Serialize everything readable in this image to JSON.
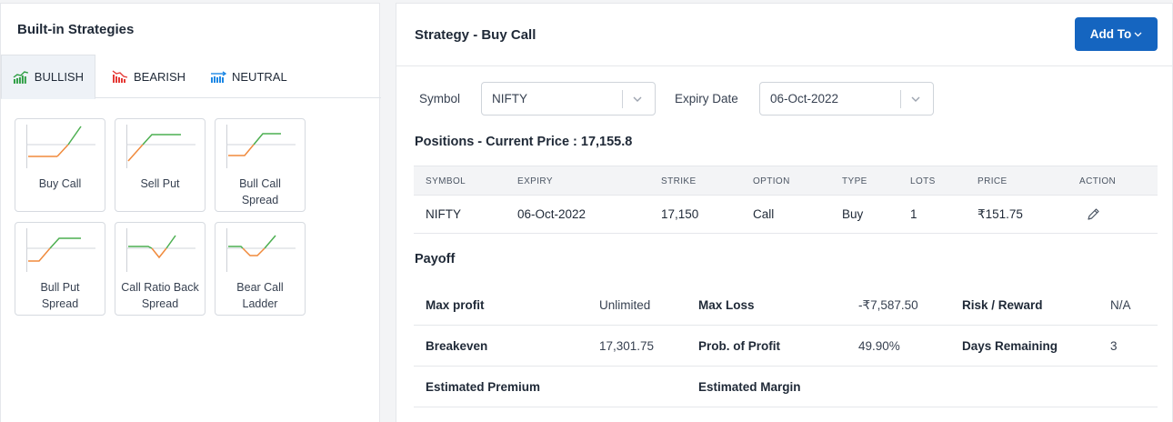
{
  "left_panel": {
    "title": "Built-in Strategies",
    "tabs": [
      {
        "label": "BULLISH",
        "icon": "bullish-chart-icon",
        "color": "#2e9e44",
        "active": true
      },
      {
        "label": "BEARISH",
        "icon": "bearish-chart-icon",
        "color": "#e53935",
        "active": false
      },
      {
        "label": "NEUTRAL",
        "icon": "neutral-chart-icon",
        "color": "#1e88e5",
        "active": false
      }
    ],
    "strategies": [
      {
        "label": "Buy Call"
      },
      {
        "label": "Sell Put"
      },
      {
        "label": "Bull Call Spread"
      },
      {
        "label": "Bull Put Spread"
      },
      {
        "label": "Call Ratio Back Spread"
      },
      {
        "label": "Bear Call Ladder"
      }
    ]
  },
  "right_panel": {
    "title": "Strategy - Buy Call",
    "add_to_label": "Add To",
    "symbol_label": "Symbol",
    "symbol_value": "NIFTY",
    "expiry_label": "Expiry Date",
    "expiry_value": "06-Oct-2022",
    "positions_title": "Positions - Current Price : 17,155.8",
    "table": {
      "headers": [
        "SYMBOL",
        "EXPIRY",
        "STRIKE",
        "OPTION",
        "TYPE",
        "LOTS",
        "PRICE",
        "ACTION"
      ],
      "rows": [
        {
          "symbol": "NIFTY",
          "expiry": "06-Oct-2022",
          "strike": "17,150",
          "option": "Call",
          "type": "Buy",
          "lots": "1",
          "price": "₹151.75",
          "action_icon": "edit-pencil-icon"
        }
      ]
    },
    "payoff": {
      "title": "Payoff",
      "max_profit_label": "Max profit",
      "max_profit_value": "Unlimited",
      "max_loss_label": "Max Loss",
      "max_loss_value": "-₹7,587.50",
      "risk_reward_label": "Risk / Reward",
      "risk_reward_value": "N/A",
      "breakeven_label": "Breakeven",
      "breakeven_value": "17,301.75",
      "prob_profit_label": "Prob. of Profit",
      "prob_profit_value": "49.90%",
      "days_remaining_label": "Days Remaining",
      "days_remaining_value": "3",
      "est_premium_label": "Estimated Premium",
      "est_margin_label": "Estimated Margin"
    }
  },
  "colors": {
    "accent": "#1565c0",
    "profit_line": "#4caf50",
    "loss_line": "#f08a3c",
    "axis_line": "#9ca3af"
  }
}
